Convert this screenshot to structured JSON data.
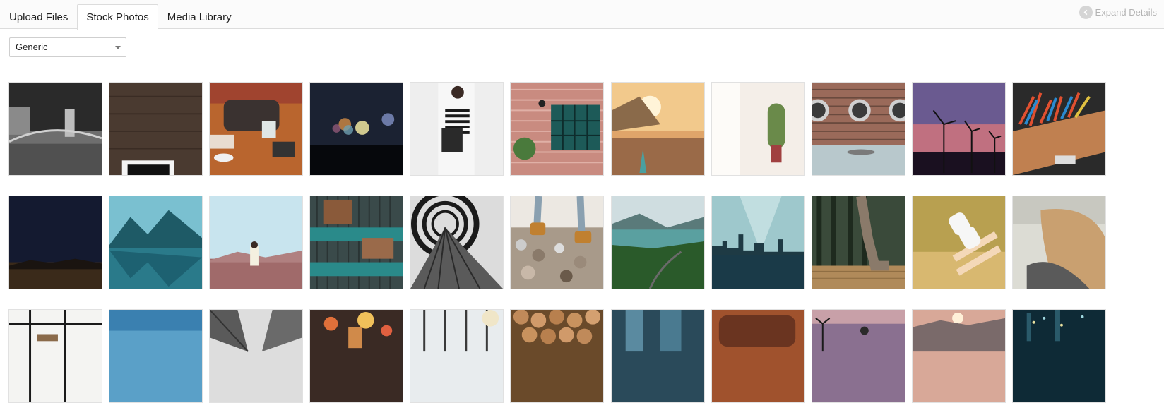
{
  "tabs": [
    {
      "label": "Upload Files",
      "active": false
    },
    {
      "label": "Stock Photos",
      "active": true
    },
    {
      "label": "Media Library",
      "active": false
    }
  ],
  "expand_details": {
    "label": "Expand Details",
    "icon": "chevron-left-icon"
  },
  "category_select": {
    "selected": "Generic"
  },
  "photos": [
    {
      "name": "bridge-night-bw"
    },
    {
      "name": "tablet-wood-desk"
    },
    {
      "name": "cafe-table-meeting"
    },
    {
      "name": "bokeh-lights"
    },
    {
      "name": "striped-shirt-person"
    },
    {
      "name": "brick-wall-window"
    },
    {
      "name": "beach-surfboard-sunset"
    },
    {
      "name": "bright-room-plant"
    },
    {
      "name": "porthole-wall"
    },
    {
      "name": "wind-turbines-dusk"
    },
    {
      "name": "colored-pencils"
    },
    {
      "name": "night-sky-field"
    },
    {
      "name": "mountain-lake-reflection"
    },
    {
      "name": "woman-desert"
    },
    {
      "name": "shipping-containers"
    },
    {
      "name": "tunnel-walkway-bw"
    },
    {
      "name": "boots-on-pebbles"
    },
    {
      "name": "lake-valley-road"
    },
    {
      "name": "city-skyline-water"
    },
    {
      "name": "forest-walk-legs"
    },
    {
      "name": "sneakers-feet-up"
    },
    {
      "name": "blonde-hair-wind"
    },
    {
      "name": "dining-room-interior"
    },
    {
      "name": "blue-sky-gradient"
    },
    {
      "name": "skyscrapers-looking-up"
    },
    {
      "name": "city-street-night"
    },
    {
      "name": "bright-windows-interior"
    },
    {
      "name": "stacked-logs"
    },
    {
      "name": "tall-buildings-teal"
    },
    {
      "name": "leather-bag"
    },
    {
      "name": "palm-trees-sunset"
    },
    {
      "name": "misty-hills-sunset"
    },
    {
      "name": "city-lights-night"
    }
  ]
}
